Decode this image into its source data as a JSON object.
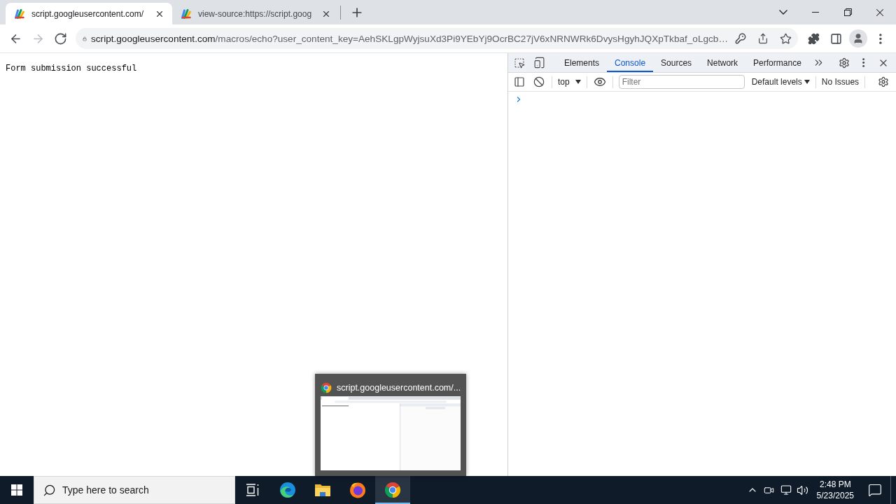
{
  "tab_strip": {
    "tabs": [
      {
        "title": "script.googleusercontent.com/",
        "selected": true
      },
      {
        "title": "view-source:https://script.goog",
        "selected": false
      }
    ]
  },
  "toolbar": {
    "nav_buttons": [
      {
        "kind": "back",
        "disabled": false
      },
      {
        "kind": "forward",
        "disabled": true
      },
      {
        "kind": "reload",
        "disabled": false
      }
    ],
    "address": {
      "host": "script.googleusercontent.com",
      "path": "/macros/echo?user_content_key=AehSKLgpWyjsuXd3Pi9YEbYj9OcrBC27jV6xNRNWRk6DvysHgyhJQXpTkbaf_oLgcb…"
    }
  },
  "page": {
    "message": "Form submission successful"
  },
  "devtools": {
    "tabs": [
      {
        "label": "Elements",
        "selected": false
      },
      {
        "label": "Console",
        "selected": true
      },
      {
        "label": "Sources",
        "selected": false
      },
      {
        "label": "Network",
        "selected": false
      },
      {
        "label": "Performance",
        "selected": false
      }
    ],
    "console_toolbar": {
      "context": "top",
      "filter": {
        "placeholder": "Filter"
      },
      "levels": "Default levels",
      "issues": "No Issues"
    }
  },
  "taskbar_preview": {
    "title": "script.googleusercontent.com/..."
  },
  "taskbar": {
    "search": {
      "placeholder": "Type here to search"
    },
    "apps": [
      {
        "kind": "task-view",
        "selected": false
      },
      {
        "kind": "edge",
        "selected": false
      },
      {
        "kind": "explorer",
        "selected": false
      },
      {
        "kind": "firefox",
        "selected": false
      },
      {
        "kind": "chrome",
        "selected": true
      }
    ],
    "clock": {
      "time": "2:48 PM",
      "date": "5/23/2025"
    }
  }
}
